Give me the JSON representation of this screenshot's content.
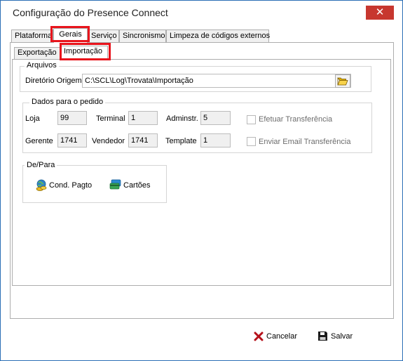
{
  "window": {
    "title": "Configuração do Presence Connect",
    "close_glyph": "✕"
  },
  "outer_tabs": [
    {
      "label": "Plataforma",
      "active": false
    },
    {
      "label": "Gerais",
      "active": true
    },
    {
      "label": "Serviço",
      "active": false
    },
    {
      "label": "Sincronismo",
      "active": false
    },
    {
      "label": "Limpeza de códigos externos",
      "active": false
    }
  ],
  "inner_tabs": [
    {
      "label": "Exportação",
      "active": false
    },
    {
      "label": "Importação",
      "active": true
    }
  ],
  "arquivos": {
    "legend": "Arquivos",
    "dir_label": "Diretório Origem",
    "dir_value": "C:\\SCL\\Log\\Trovata\\Importação",
    "browse_icon": "folder-open-icon"
  },
  "pedido": {
    "legend": "Dados para o pedido",
    "loja_label": "Loja",
    "loja_value": "99",
    "terminal_label": "Terminal",
    "terminal_value": "1",
    "adminstr_label": "Adminstr.",
    "adminstr_value": "5",
    "gerente_label": "Gerente",
    "gerente_value": "1741",
    "vendedor_label": "Vendedor",
    "vendedor_value": "1741",
    "template_label": "Template",
    "template_value": "1",
    "efetuar_label": "Efetuar Transferência",
    "efetuar_checked": false,
    "enviar_label": "Enviar Email Transferência",
    "enviar_checked": false
  },
  "depara": {
    "legend": "De/Para",
    "cond_label": "Cond. Pagto",
    "cartoes_label": "Cartões"
  },
  "footer": {
    "cancel_label": "Cancelar",
    "save_label": "Salvar"
  },
  "colors": {
    "highlight": "#e8141c",
    "close_bg": "#c7372f",
    "cancel_icon": "#b5101a",
    "save_icon": "#111111"
  }
}
